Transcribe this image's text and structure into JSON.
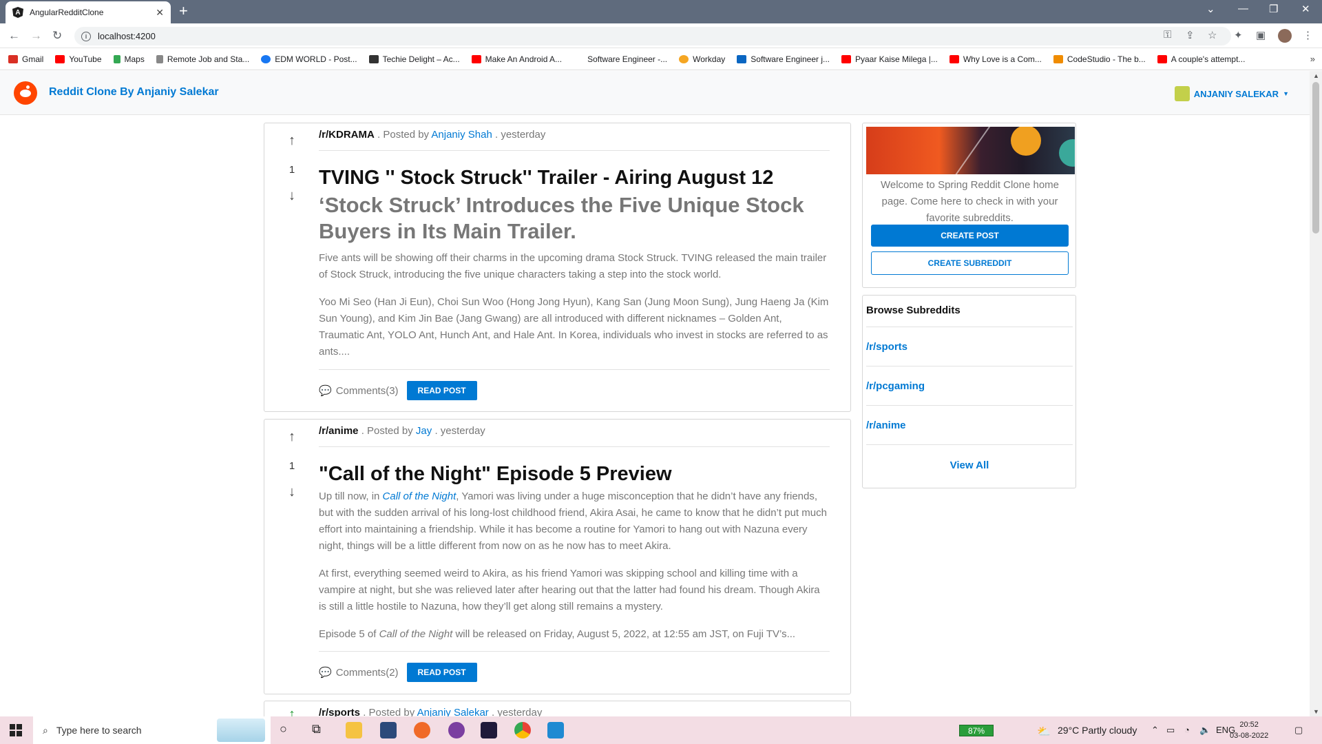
{
  "browser": {
    "tab_title": "AngularRedditClone",
    "url": "localhost:4200",
    "bookmarks": [
      {
        "label": "Gmail",
        "color": "#d93025"
      },
      {
        "label": "YouTube",
        "color": "#ff0000"
      },
      {
        "label": "Maps",
        "color": "#34a853"
      },
      {
        "label": "Remote Job and Sta...",
        "color": "#666666"
      },
      {
        "label": "EDM WORLD - Post...",
        "color": "#1877f2"
      },
      {
        "label": "Techie Delight – Ac...",
        "color": "#333333"
      },
      {
        "label": "Make An Android A...",
        "color": "#ff0000"
      },
      {
        "label": "Software Engineer -...",
        "color": "#ffffff"
      },
      {
        "label": "Workday",
        "color": "#f5a623"
      },
      {
        "label": "Software Engineer j...",
        "color": "#0a66c2"
      },
      {
        "label": "Pyaar Kaise Milega |...",
        "color": "#ff0000"
      },
      {
        "label": "Why Love is a Com...",
        "color": "#ff0000"
      },
      {
        "label": "CodeStudio - The b...",
        "color": "#f08c00"
      },
      {
        "label": "A couple's attempt...",
        "color": "#ff0000"
      }
    ]
  },
  "app": {
    "brand": "Reddit Clone By Anjaniy Salekar",
    "user": "ANJANIY SALEKAR",
    "accent": "#0079d3"
  },
  "posts": [
    {
      "subreddit": "/r/KDRAMA",
      "posted_by": ". Posted by",
      "author": "Anjaniy Shah",
      "time": ". yesterday",
      "votes": "1",
      "title": "TVING '' Stock Struck'' Trailer - Airing August 12",
      "subtitle": "‘Stock Struck’ Introduces the Five Unique Stock Buyers in Its Main Trailer.",
      "p1": "Five ants will be showing off their charms in the upcoming drama Stock Struck. TVING released the main trailer of Stock Struck, introducing the five unique characters taking a step into the stock world.",
      "p2": "Yoo Mi Seo (Han Ji Eun), Choi Sun Woo (Hong Jong Hyun), Kang San (Jung Moon Sung), Jung Haeng Ja (Kim Sun Young), and Kim Jin Bae (Jang Gwang) are all introduced with different nicknames – Golden Ant, Traumatic Ant, YOLO Ant, Hunch Ant, and Hale Ant. In Korea, individuals who invest in stocks are referred to as ants....",
      "comments": "Comments(3)",
      "read": "READ POST"
    },
    {
      "subreddit": "/r/anime",
      "posted_by": ". Posted by",
      "author": "Jay",
      "time": ". yesterday",
      "votes": "1",
      "title": "\"Call of the Night\" Episode 5 Preview",
      "p1_a": "Up till now, in ",
      "p1_link": "Call of the Night",
      "p1_b": ", Yamori was living under a huge misconception that he didn’t have any friends, but with the sudden arrival of his long-lost childhood friend, Akira Asai, he came to know that he didn’t put much effort into maintaining a friendship. While it has become a routine for Yamori to hang out with Nazuna every night, things will be a little different from now on as he now has to meet Akira.",
      "p2": "At first, everything seemed weird to Akira, as his friend Yamori was skipping school and killing time with a vampire at night, but she was relieved later after hearing out that the latter had found his dream. Though Akira is still a little hostile to Nazuna, how they’ll get along still remains a mystery.",
      "p3_a": "Episode 5 of ",
      "p3_em": "Call of the Night",
      "p3_b": " will be released on Friday, August 5, 2022, at 12:55 am JST, on Fuji TV’s...",
      "comments": "Comments(2)",
      "read": "READ POST"
    },
    {
      "subreddit": "/r/sports",
      "posted_by": ". Posted by",
      "author": "Anjaniy Salekar",
      "time": ". yesterday"
    }
  ],
  "sidebar": {
    "welcome": "Welcome to Spring Reddit Clone home page. Come here to check in with your favorite subreddits.",
    "create_post": "CREATE POST",
    "create_subreddit": "CREATE SUBREDDIT",
    "browse_title": "Browse Subreddits",
    "subreddits": [
      "/r/sports",
      "/r/pcgaming",
      "/r/anime"
    ],
    "view_all": "View All"
  },
  "taskbar": {
    "search_placeholder": "Type here to search",
    "battery": "87%",
    "weather": "29°C  Partly cloudy",
    "lang": "ENG",
    "time": "20:52",
    "date": "03-08-2022"
  }
}
